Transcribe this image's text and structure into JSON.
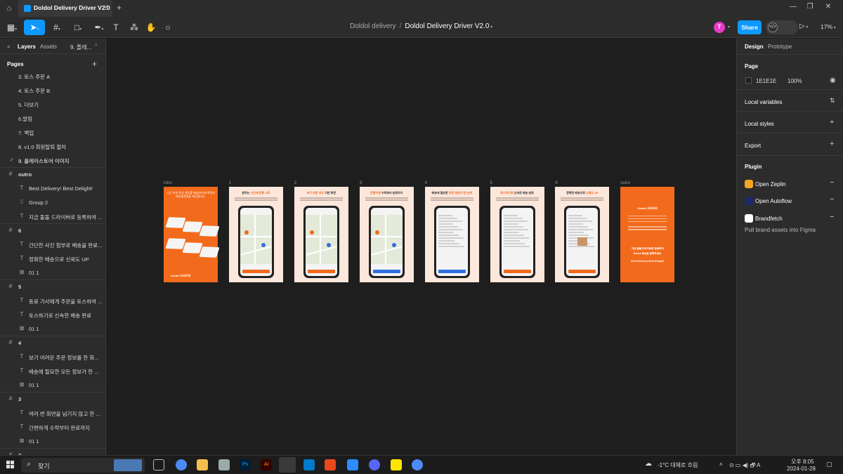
{
  "titlebar": {
    "tab_title": "Doldol Delivery Driver V2.0"
  },
  "toolbar": {
    "project": "Doldol delivery",
    "file": "Doldol Delivery Driver V2.0",
    "avatar_letter": "T",
    "share_label": "Share",
    "zoom": "17%"
  },
  "left_panel": {
    "tabs": [
      "Layers",
      "Assets",
      "9. 플레..."
    ],
    "pages_header": "Pages",
    "pages": [
      "3. 토스 주문 A",
      "4. 토스 주문 B",
      "5. 더보기",
      "6.알림",
      "7. 백업",
      "8. v1.0 회원탈퇴 절차",
      "9. 플레이스토어 이미지"
    ],
    "layers": [
      {
        "type": "frame",
        "label": "outro"
      },
      {
        "type": "text",
        "label": "Best Delivery! Best Delight!"
      },
      {
        "type": "group",
        "label": "Group 2"
      },
      {
        "type": "text",
        "label": "지금 돌돌 드라이버로 등록하여 ..."
      },
      {
        "type": "frame",
        "label": "6"
      },
      {
        "type": "text",
        "label": "간단한 사진 첨부로 배송을 완료..."
      },
      {
        "type": "text",
        "label": "정확한 배송으로 신뢰도 UP"
      },
      {
        "type": "image",
        "label": "01 1"
      },
      {
        "type": "frame",
        "label": "5"
      },
      {
        "type": "text",
        "label": "동료 기사에게 주문을 토스하여 ..."
      },
      {
        "type": "text",
        "label": "토스하기로 신속한 배송 완료"
      },
      {
        "type": "image",
        "label": "01 1"
      },
      {
        "type": "frame",
        "label": "4"
      },
      {
        "type": "text",
        "label": "보기 어려운 주문 정보를 한 화..."
      },
      {
        "type": "text",
        "label": "배송에 필요한 모든 정보가 한 ..."
      },
      {
        "type": "image",
        "label": "01 1"
      },
      {
        "type": "frame",
        "label": "3"
      },
      {
        "type": "text",
        "label": "여러 번 화면을 넘기지 않고 한 ..."
      },
      {
        "type": "text",
        "label": "간편하게 수락부터 완료까지"
      },
      {
        "type": "image",
        "label": "01 1"
      },
      {
        "type": "frame",
        "label": "2"
      }
    ]
  },
  "right_panel": {
    "tabs": [
      "Design",
      "Prototype"
    ],
    "page_header": "Page",
    "page_color": "1E1E1E",
    "page_opacity": "100%",
    "local_variables": "Local variables",
    "local_styles": "Local styles",
    "export": "Export",
    "plugin_header": "Plugin",
    "plugins": [
      "Open Zeplin",
      "Open Autoflow",
      "Brandfetch"
    ],
    "plugin_note": "Pull brand assets into Figma"
  },
  "canvas": {
    "frames": [
      {
        "label": "intro",
        "head": "시간·비용·동선 관리를 배송관리에 최적의 배송플랫폼을 제공합니다.",
        "logo": "Doldol 드라이버"
      },
      {
        "label": "1",
        "head_pre": "원하는 ",
        "head_hl": "시간에 운행 시작",
        "head_post": ""
      },
      {
        "label": "2",
        "head_pre": "",
        "head_hl": "보기 쉬운 지도",
        "head_post": " 기반 화면"
      },
      {
        "label": "3",
        "head_pre": "",
        "head_hl": "간편하게",
        "head_post": " 수락부터 완료까지"
      },
      {
        "label": "4",
        "head_pre": "배송에 필요한 ",
        "head_hl": "모든 정보가 한 눈에",
        "head_post": ""
      },
      {
        "label": "5",
        "head_pre": "",
        "head_hl": "토스하기로",
        "head_post": " 신속한 배송 완료"
      },
      {
        "label": "6",
        "head_pre": "정확한 배송으로 ",
        "head_hl": "신뢰도 UP",
        "head_post": ""
      },
      {
        "label": "outro",
        "logo": "Doldol 드라이버",
        "line1": "지금 돌돌 드라이버로 등록하여",
        "line2": "Doldol 배송을 운행하세요.",
        "line3": "Best Delivery! Best Delight!"
      }
    ]
  },
  "taskbar": {
    "search_text": "찾기",
    "weather": "-1°C 대체로 흐림",
    "time": "오후 8:05",
    "date": "2024-01-28"
  },
  "colors": {
    "accent": "#0d99ff",
    "brand_orange": "#f26a1b",
    "frame_bg": "#fce7dc"
  }
}
